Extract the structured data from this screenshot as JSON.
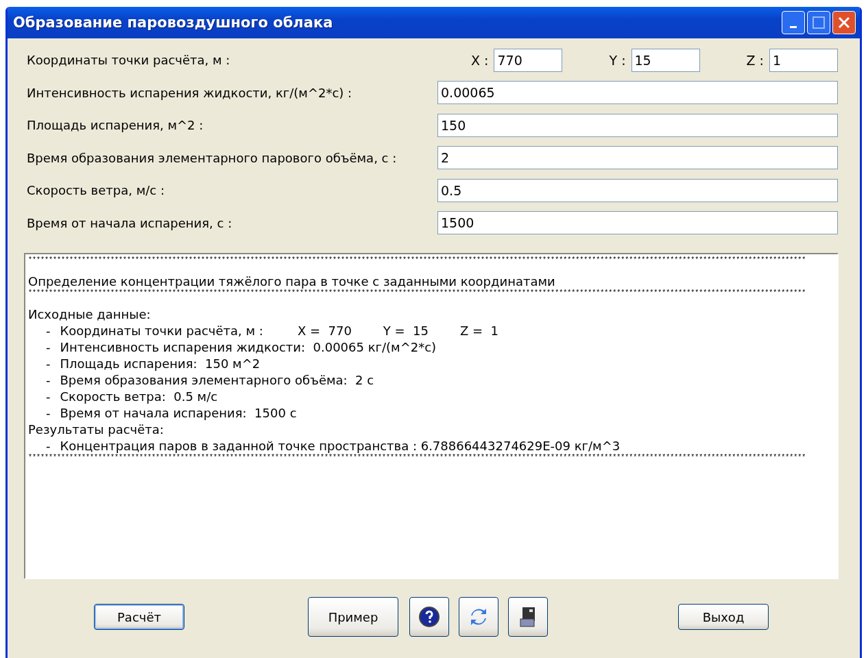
{
  "window": {
    "title": "Образование паровоздушного облака"
  },
  "coords": {
    "label": "Координаты точки расчёта, м :",
    "axes": [
      {
        "label": "X :",
        "value": "770"
      },
      {
        "label": "Y :",
        "value": "15"
      },
      {
        "label": "Z :",
        "value": "1"
      }
    ]
  },
  "fields": [
    {
      "label": "Интенсивность испарения жидкости, кг/(м^2*с) :",
      "value": "0.00065"
    },
    {
      "label": "Площадь испарения, м^2 :",
      "value": "150"
    },
    {
      "label": "Время образования элементарного парового объёма, с :",
      "value": "2"
    },
    {
      "label": "Скорость ветра, м/с :",
      "value": "0.5"
    },
    {
      "label": "Время от начала испарения, с :",
      "value": "1500"
    }
  ],
  "log": [
    {
      "kind": "rule",
      "text": "*********************************************************************************************************************************************************************************************"
    },
    {
      "kind": "gap"
    },
    {
      "kind": "plain",
      "text": "Определение концентрации тяжёлого пара в точке с заданными координатами"
    },
    {
      "kind": "rule",
      "text": "*********************************************************************************************************************************************************************************************"
    },
    {
      "kind": "gap"
    },
    {
      "kind": "plain",
      "text": "Исходные данные:"
    },
    {
      "kind": "item",
      "marker": "-",
      "text": "Координаты точки расчёта, м :",
      "extra": [
        "X =  770",
        "Y =  15",
        "Z =  1"
      ]
    },
    {
      "kind": "item",
      "marker": "-",
      "text": "Интенсивность испарения жидкости:  0.00065 кг/(м^2*с)"
    },
    {
      "kind": "item",
      "marker": "-",
      "text": "Площадь испарения:  150 м^2"
    },
    {
      "kind": "item",
      "marker": "-",
      "text": "Время образования элементарного объёма:  2 с"
    },
    {
      "kind": "item",
      "marker": "-",
      "text": "Скорость ветра:  0.5 м/с"
    },
    {
      "kind": "item",
      "marker": "-",
      "text": "Время от начала испарения:  1500 с"
    },
    {
      "kind": "plain",
      "text": "Результаты расчёта:"
    },
    {
      "kind": "item",
      "marker": "-",
      "text": "Концентрация паров в заданной точке пространства : 6.78866443274629E-09 кг/м^3"
    },
    {
      "kind": "rule",
      "text": "*********************************************************************************************************************************************************************************************"
    }
  ],
  "buttons": [
    {
      "kind": "text",
      "label": "Расчёт",
      "focused": true
    },
    {
      "kind": "large",
      "label": "Пример",
      "focused": false
    },
    {
      "kind": "icon"
    },
    {
      "kind": "icon"
    },
    {
      "kind": "icon"
    },
    {
      "kind": "text",
      "label": "Выход",
      "focused": false
    }
  ]
}
